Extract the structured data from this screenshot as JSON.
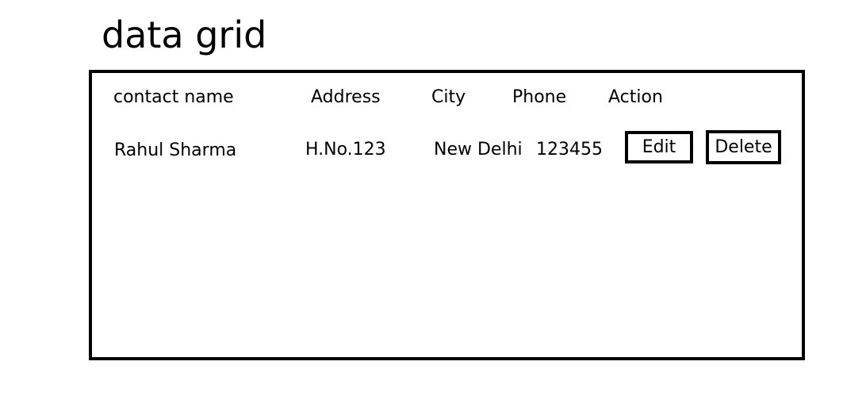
{
  "page": {
    "title": "data grid"
  },
  "grid": {
    "columns": [
      "contact name",
      "Address",
      "City",
      "Phone",
      "Action"
    ],
    "rows": [
      {
        "contact_name": "Rahul Sharma",
        "address": "H.No.123",
        "city": "New Delhi",
        "phone": "123455",
        "actions": {
          "edit_label": "Edit",
          "delete_label": "Delete"
        }
      }
    ]
  }
}
